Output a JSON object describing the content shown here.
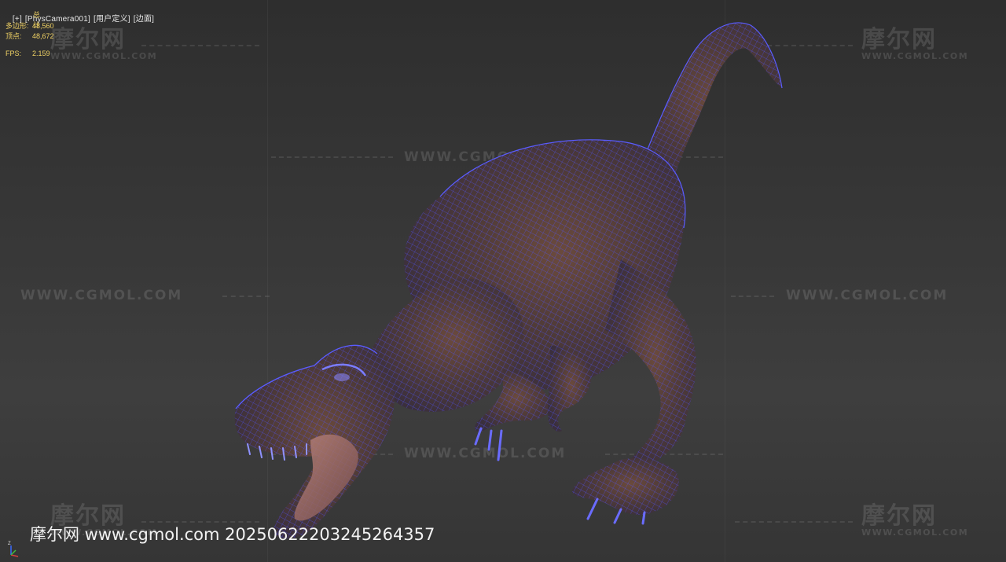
{
  "viewport": {
    "label_parts": [
      "[+]",
      "[PhysCamera001]",
      "[用户定义]",
      "[边面]"
    ]
  },
  "stats": {
    "title": "总计",
    "polygons_label": "多边形:",
    "polygons_value": "48,560",
    "vertices_label": "顶点:",
    "vertices_value": "48,672",
    "fps_label": "FPS:",
    "fps_value": "2.159"
  },
  "watermark": {
    "logo": "摩尔网",
    "sub": "WWW.CGMOL.COM",
    "url": "WWW.CGMOL.COM"
  },
  "caption": "摩尔网 www.cgmol.com 20250622203245264357",
  "model": {
    "name": "dinosaur-wireframe-model",
    "wire_color": "#4d52ff",
    "skin_color": "#5a4038"
  },
  "gizmo": {
    "z_label": "Z"
  }
}
